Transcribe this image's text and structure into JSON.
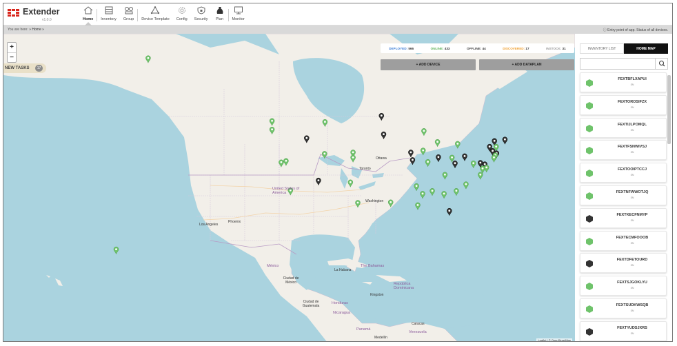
{
  "app": {
    "name": "Extender",
    "version": "v1.0.0"
  },
  "nav": [
    {
      "label": "Home",
      "icon": "home-icon",
      "active": true
    },
    {
      "label": "Inventory",
      "icon": "inventory-icon"
    },
    {
      "label": "Group",
      "icon": "group-icon"
    },
    {
      "label": "Device Template",
      "icon": "device-template-icon"
    },
    {
      "label": "Config",
      "icon": "config-icon"
    },
    {
      "label": "Security",
      "icon": "security-icon"
    },
    {
      "label": "Plan",
      "icon": "plan-icon"
    },
    {
      "label": "Monitor",
      "icon": "monitor-icon"
    }
  ],
  "breadcrumb": {
    "prefix": "You are here:",
    "path": "» Home »"
  },
  "info": "Entry point of app. Status of all devices.",
  "stats": {
    "deployed_label": "DEPLOYED:",
    "deployed": "566",
    "online_label": "ONLINE:",
    "online": "433",
    "offline_label": "OFFLINE:",
    "offline": "44",
    "discovered_label": "DISCOVERED:",
    "discovered": "17",
    "instock_label": "INSTOCK:",
    "instock": "31"
  },
  "buttons": {
    "add_device": "+ ADD DEVICE",
    "add_dataplan": "+ ADD DATAPLAN"
  },
  "new_tasks": {
    "label": "NEW TASKS",
    "count": "17"
  },
  "zoom": {
    "in": "+",
    "out": "−"
  },
  "attribution": "Leaflet | © OpenStreetMap",
  "map_labels": {
    "ottawa": "Ottawa",
    "toronto": "Toronto",
    "usa": "United States of America",
    "washington": "Washington",
    "los_angeles": "Los Angeles",
    "phoenix": "Phoenix",
    "mexico": "México",
    "mexico_city": "Ciudad de México",
    "la_habana": "La Habana",
    "bahamas": "The Bahamas",
    "dominican": "República Dominicana",
    "kingston": "Kingston",
    "guatemala": "Ciudad de Guatemala",
    "honduras": "Honduras",
    "nicaragua": "Nicaragua",
    "panama": "Panamá",
    "caracas": "Caracas",
    "venezuela": "Venezuela",
    "medellin": "Medellín"
  },
  "tabs": {
    "list": "INVENTORY LIST",
    "map": "HOME MAP"
  },
  "search": {
    "placeholder": ""
  },
  "status_colors": {
    "online": "#6fc36b",
    "offline": "#333333",
    "deployed": "#3a7bd5",
    "discovered": "#f0a030",
    "instock": "#999999"
  },
  "devices": [
    {
      "name": "FEXTBFLXAPUI",
      "sn": "SN",
      "status": "online"
    },
    {
      "name": "FEXTOROSIFZX",
      "sn": "SN",
      "status": "online"
    },
    {
      "name": "FEXTIJLPOMQL",
      "sn": "SN",
      "status": "online"
    },
    {
      "name": "FEXTFSNWIVSJ",
      "sn": "SN",
      "status": "online"
    },
    {
      "name": "FEXTOOIPTCCJ",
      "sn": "SN",
      "status": "online"
    },
    {
      "name": "FEXTNFWWOTJQ",
      "sn": "SN",
      "status": "online"
    },
    {
      "name": "FEXTKECFNMYP",
      "sn": "SN",
      "status": "offline"
    },
    {
      "name": "FEXTECMFOOOB",
      "sn": "SN",
      "status": "online"
    },
    {
      "name": "FEXTDFETOURD",
      "sn": "SN",
      "status": "offline"
    },
    {
      "name": "FEXTSJGOKLYU",
      "sn": "SN",
      "status": "online"
    },
    {
      "name": "FEXTSUDKWSQB",
      "sn": "SN",
      "status": "online"
    },
    {
      "name": "FEXTYUDSJXRS",
      "sn": "SN",
      "status": "offline"
    }
  ],
  "markers": [
    {
      "status": "online",
      "lon": -151.2,
      "lat": 60.4
    },
    {
      "status": "online",
      "lon": -122.9,
      "lat": 47.2
    },
    {
      "status": "online",
      "lon": -122.9,
      "lat": 45.4
    },
    {
      "status": "online",
      "lon": -110.8,
      "lat": 47.0
    },
    {
      "status": "offline",
      "lon": -97.9,
      "lat": 48.3
    },
    {
      "status": "offline",
      "lon": -115.0,
      "lat": 43.6
    },
    {
      "status": "offline",
      "lon": -97.4,
      "lat": 44.4
    },
    {
      "status": "online",
      "lon": -88.2,
      "lat": 45.1
    },
    {
      "status": "online",
      "lon": -110.9,
      "lat": 40.3
    },
    {
      "status": "online",
      "lon": -104.4,
      "lat": 40.6
    },
    {
      "status": "online",
      "lon": -104.4,
      "lat": 39.5
    },
    {
      "status": "online",
      "lon": -120.8,
      "lat": 38.5
    },
    {
      "status": "online",
      "lon": -119.7,
      "lat": 38.8
    },
    {
      "status": "offline",
      "lon": -91.2,
      "lat": 40.6
    },
    {
      "status": "offline",
      "lon": -90.8,
      "lat": 39.0
    },
    {
      "status": "online",
      "lon": -88.4,
      "lat": 41.0
    },
    {
      "status": "online",
      "lon": -85.1,
      "lat": 42.8
    },
    {
      "status": "online",
      "lon": -80.5,
      "lat": 42.4
    },
    {
      "status": "offline",
      "lon": -84.9,
      "lat": 39.6
    },
    {
      "status": "online",
      "lon": -81.8,
      "lat": 39.5
    },
    {
      "status": "online",
      "lon": -87.3,
      "lat": 38.6
    },
    {
      "status": "offline",
      "lon": -78.9,
      "lat": 39.8
    },
    {
      "status": "offline",
      "lon": -81.1,
      "lat": 38.3
    },
    {
      "status": "online",
      "lon": -76.9,
      "lat": 38.3
    },
    {
      "status": "offline",
      "lon": -72.1,
      "lat": 43.0
    },
    {
      "status": "offline",
      "lon": -69.7,
      "lat": 43.3
    },
    {
      "status": "offline",
      "lon": -73.2,
      "lat": 41.8
    },
    {
      "status": "online",
      "lon": -71.7,
      "lat": 41.8
    },
    {
      "status": "offline",
      "lon": -72.5,
      "lat": 40.9
    },
    {
      "status": "offline",
      "lon": -71.6,
      "lat": 40.4
    },
    {
      "status": "online",
      "lon": -71.9,
      "lat": 40.0
    },
    {
      "status": "online",
      "lon": -72.2,
      "lat": 39.5
    },
    {
      "status": "offline",
      "lon": -75.3,
      "lat": 38.4
    },
    {
      "status": "offline",
      "lon": -74.3,
      "lat": 38.1
    },
    {
      "status": "online",
      "lon": -74.8,
      "lat": 37.2
    },
    {
      "status": "online",
      "lon": -73.9,
      "lat": 37.4
    },
    {
      "status": "online",
      "lon": -75.3,
      "lat": 35.9
    },
    {
      "status": "online",
      "lon": -83.4,
      "lat": 35.9
    },
    {
      "status": "online",
      "lon": -78.6,
      "lat": 33.9
    },
    {
      "status": "online",
      "lon": -80.8,
      "lat": 32.5
    },
    {
      "status": "online",
      "lon": -83.6,
      "lat": 31.9
    },
    {
      "status": "online",
      "lon": -89.9,
      "lat": 33.5
    },
    {
      "status": "online",
      "lon": -88.5,
      "lat": 31.9
    },
    {
      "status": "online",
      "lon": -86.3,
      "lat": 32.5
    },
    {
      "status": "online",
      "lon": -89.6,
      "lat": 29.5
    },
    {
      "status": "online",
      "lon": -95.8,
      "lat": 30.1
    },
    {
      "status": "offline",
      "lon": -82.4,
      "lat": 28.3
    },
    {
      "status": "online",
      "lon": -103.3,
      "lat": 30.0
    },
    {
      "status": "online",
      "lon": -105.0,
      "lat": 34.3
    },
    {
      "status": "offline",
      "lon": -112.3,
      "lat": 34.7
    },
    {
      "status": "online",
      "lon": -118.7,
      "lat": 32.6
    },
    {
      "status": "online",
      "lon": -158.5,
      "lat": 20.2
    }
  ]
}
